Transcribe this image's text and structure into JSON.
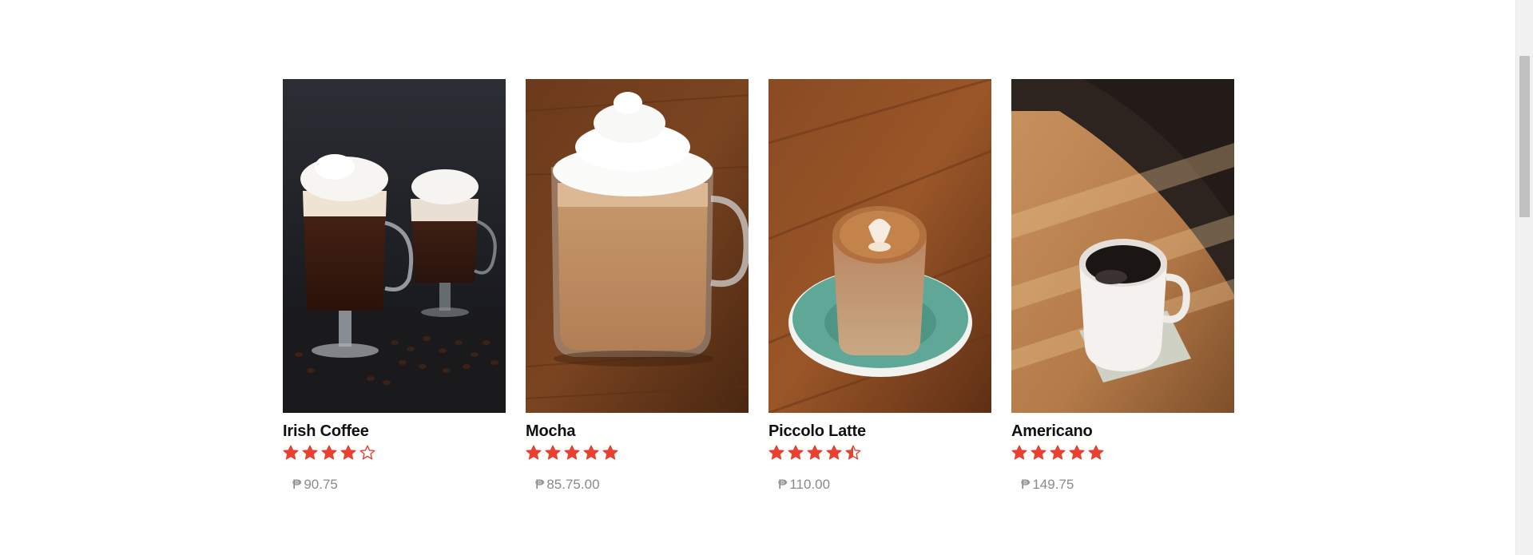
{
  "currency_symbol": "₱",
  "products": [
    {
      "name": "Irish Coffee",
      "rating": 4,
      "price": "90.75"
    },
    {
      "name": "Mocha",
      "rating": 5,
      "price": "85.75.00"
    },
    {
      "name": "Piccolo Latte",
      "rating": 4.5,
      "price": "110.00"
    },
    {
      "name": "Americano",
      "rating": 5,
      "price": "149.75"
    }
  ],
  "colors": {
    "star": "#e8412e",
    "price": "#8a8a8a",
    "title": "#111111"
  }
}
